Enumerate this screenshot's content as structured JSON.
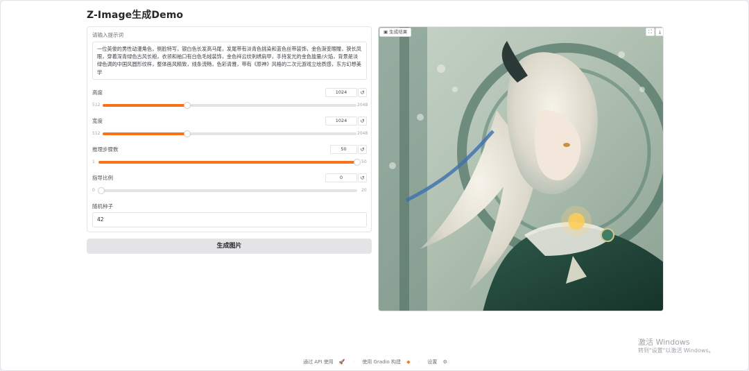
{
  "app": {
    "title": "Z-Image生成Demo"
  },
  "prompt": {
    "label": "请输入提示词",
    "value": "一位英俊的男性动漫角色，侧脸特写，银白色长发高马尾，发尾带有淡青色挑染和蓝色丝带装饰，金色渐变眼瞳，狭长凤眼，穿着深青绿色古风长袍，衣领和袖口有白色毛绒装饰，金色祥云纹刺绣肩甲，手持发光的金色能量/火焰，背景是淡绿色调的中国风圆形纹样，整体画风精致，线条流畅，色彩清雅，带有《原神》风格的二次元游戏立绘质感，东方幻想美学"
  },
  "sliders": [
    {
      "label": "高度",
      "value": "1024",
      "min": "512",
      "max": "2048",
      "fraction": 0.333
    },
    {
      "label": "宽度",
      "value": "1024",
      "min": "512",
      "max": "2048",
      "fraction": 0.333
    },
    {
      "label": "推理步骤数",
      "value": "50",
      "min": "1",
      "max": "50",
      "fraction": 1.0
    },
    {
      "label": "指导比例",
      "value": "0",
      "min": "0",
      "max": "20",
      "fraction": 0.0
    }
  ],
  "seed": {
    "label": "随机种子",
    "value": "42"
  },
  "generate_button": {
    "label": "生成图片"
  },
  "output": {
    "badge": "生成结果",
    "fullscreen_icon": "fullscreen-icon",
    "download_icon": "download-icon"
  },
  "reset_icon_glyph": "↺",
  "watermark": {
    "line1": "激活 Windows",
    "line2": "转到\"设置\"以激活 Windows。"
  },
  "footer": {
    "api": "通过 API 使用",
    "gradio": "使用 Gradio 构建",
    "settings": "设置"
  },
  "colors": {
    "accent": "#f97316",
    "button_bg": "#e4e4e7"
  }
}
